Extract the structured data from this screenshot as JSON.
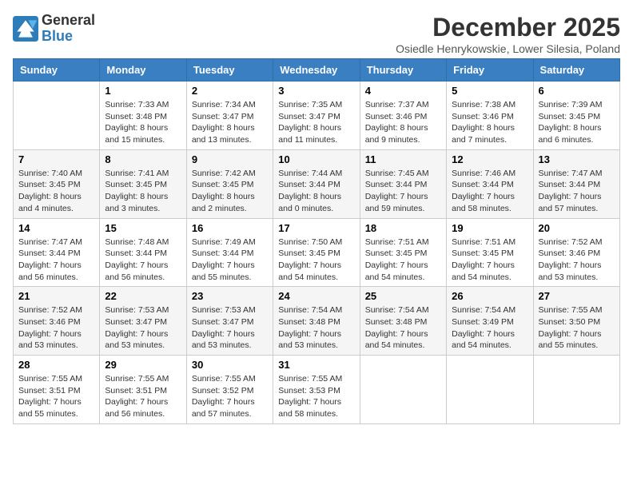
{
  "logo": {
    "general": "General",
    "blue": "Blue"
  },
  "title": "December 2025",
  "location": "Osiedle Henrykowskie, Lower Silesia, Poland",
  "headers": [
    "Sunday",
    "Monday",
    "Tuesday",
    "Wednesday",
    "Thursday",
    "Friday",
    "Saturday"
  ],
  "weeks": [
    [
      {
        "day": "",
        "content": ""
      },
      {
        "day": "1",
        "content": "Sunrise: 7:33 AM\nSunset: 3:48 PM\nDaylight: 8 hours\nand 15 minutes."
      },
      {
        "day": "2",
        "content": "Sunrise: 7:34 AM\nSunset: 3:47 PM\nDaylight: 8 hours\nand 13 minutes."
      },
      {
        "day": "3",
        "content": "Sunrise: 7:35 AM\nSunset: 3:47 PM\nDaylight: 8 hours\nand 11 minutes."
      },
      {
        "day": "4",
        "content": "Sunrise: 7:37 AM\nSunset: 3:46 PM\nDaylight: 8 hours\nand 9 minutes."
      },
      {
        "day": "5",
        "content": "Sunrise: 7:38 AM\nSunset: 3:46 PM\nDaylight: 8 hours\nand 7 minutes."
      },
      {
        "day": "6",
        "content": "Sunrise: 7:39 AM\nSunset: 3:45 PM\nDaylight: 8 hours\nand 6 minutes."
      }
    ],
    [
      {
        "day": "7",
        "content": "Sunrise: 7:40 AM\nSunset: 3:45 PM\nDaylight: 8 hours\nand 4 minutes."
      },
      {
        "day": "8",
        "content": "Sunrise: 7:41 AM\nSunset: 3:45 PM\nDaylight: 8 hours\nand 3 minutes."
      },
      {
        "day": "9",
        "content": "Sunrise: 7:42 AM\nSunset: 3:45 PM\nDaylight: 8 hours\nand 2 minutes."
      },
      {
        "day": "10",
        "content": "Sunrise: 7:44 AM\nSunset: 3:44 PM\nDaylight: 8 hours\nand 0 minutes."
      },
      {
        "day": "11",
        "content": "Sunrise: 7:45 AM\nSunset: 3:44 PM\nDaylight: 7 hours\nand 59 minutes."
      },
      {
        "day": "12",
        "content": "Sunrise: 7:46 AM\nSunset: 3:44 PM\nDaylight: 7 hours\nand 58 minutes."
      },
      {
        "day": "13",
        "content": "Sunrise: 7:47 AM\nSunset: 3:44 PM\nDaylight: 7 hours\nand 57 minutes."
      }
    ],
    [
      {
        "day": "14",
        "content": "Sunrise: 7:47 AM\nSunset: 3:44 PM\nDaylight: 7 hours\nand 56 minutes."
      },
      {
        "day": "15",
        "content": "Sunrise: 7:48 AM\nSunset: 3:44 PM\nDaylight: 7 hours\nand 56 minutes."
      },
      {
        "day": "16",
        "content": "Sunrise: 7:49 AM\nSunset: 3:44 PM\nDaylight: 7 hours\nand 55 minutes."
      },
      {
        "day": "17",
        "content": "Sunrise: 7:50 AM\nSunset: 3:45 PM\nDaylight: 7 hours\nand 54 minutes."
      },
      {
        "day": "18",
        "content": "Sunrise: 7:51 AM\nSunset: 3:45 PM\nDaylight: 7 hours\nand 54 minutes."
      },
      {
        "day": "19",
        "content": "Sunrise: 7:51 AM\nSunset: 3:45 PM\nDaylight: 7 hours\nand 54 minutes."
      },
      {
        "day": "20",
        "content": "Sunrise: 7:52 AM\nSunset: 3:46 PM\nDaylight: 7 hours\nand 53 minutes."
      }
    ],
    [
      {
        "day": "21",
        "content": "Sunrise: 7:52 AM\nSunset: 3:46 PM\nDaylight: 7 hours\nand 53 minutes."
      },
      {
        "day": "22",
        "content": "Sunrise: 7:53 AM\nSunset: 3:47 PM\nDaylight: 7 hours\nand 53 minutes."
      },
      {
        "day": "23",
        "content": "Sunrise: 7:53 AM\nSunset: 3:47 PM\nDaylight: 7 hours\nand 53 minutes."
      },
      {
        "day": "24",
        "content": "Sunrise: 7:54 AM\nSunset: 3:48 PM\nDaylight: 7 hours\nand 53 minutes."
      },
      {
        "day": "25",
        "content": "Sunrise: 7:54 AM\nSunset: 3:48 PM\nDaylight: 7 hours\nand 54 minutes."
      },
      {
        "day": "26",
        "content": "Sunrise: 7:54 AM\nSunset: 3:49 PM\nDaylight: 7 hours\nand 54 minutes."
      },
      {
        "day": "27",
        "content": "Sunrise: 7:55 AM\nSunset: 3:50 PM\nDaylight: 7 hours\nand 55 minutes."
      }
    ],
    [
      {
        "day": "28",
        "content": "Sunrise: 7:55 AM\nSunset: 3:51 PM\nDaylight: 7 hours\nand 55 minutes."
      },
      {
        "day": "29",
        "content": "Sunrise: 7:55 AM\nSunset: 3:51 PM\nDaylight: 7 hours\nand 56 minutes."
      },
      {
        "day": "30",
        "content": "Sunrise: 7:55 AM\nSunset: 3:52 PM\nDaylight: 7 hours\nand 57 minutes."
      },
      {
        "day": "31",
        "content": "Sunrise: 7:55 AM\nSunset: 3:53 PM\nDaylight: 7 hours\nand 58 minutes."
      },
      {
        "day": "",
        "content": ""
      },
      {
        "day": "",
        "content": ""
      },
      {
        "day": "",
        "content": ""
      }
    ]
  ]
}
